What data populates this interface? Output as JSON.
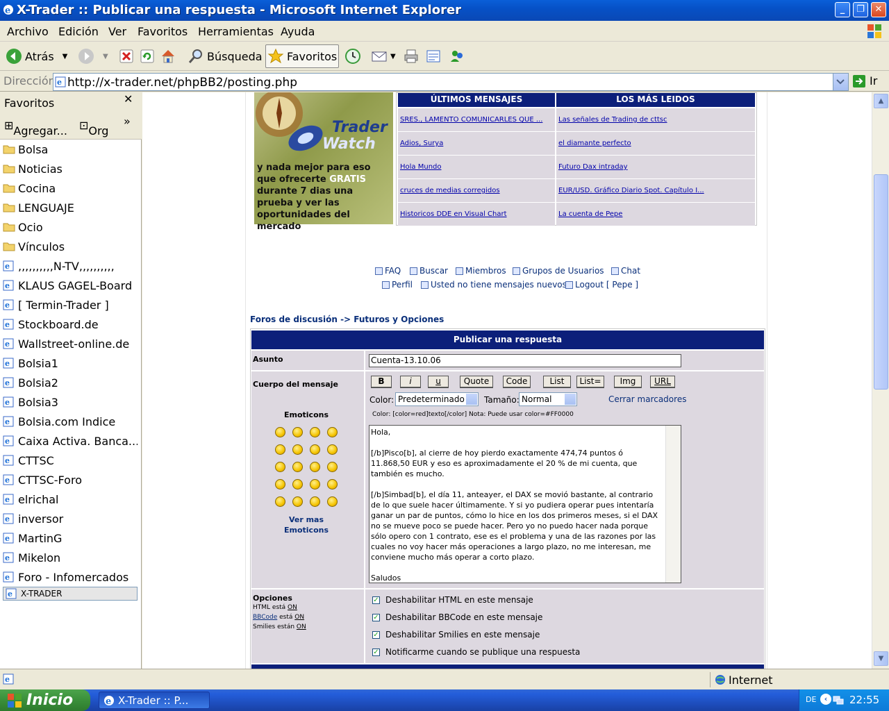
{
  "window": {
    "title": "X-Trader :: Publicar una respuesta - Microsoft Internet Explorer"
  },
  "menu": [
    "Archivo",
    "Edición",
    "Ver",
    "Favoritos",
    "Herramientas",
    "Ayuda"
  ],
  "toolbar": {
    "back": "Atrás",
    "search": "Búsqueda",
    "favorites": "Favoritos"
  },
  "address": {
    "label": "Dirección",
    "url": "http://x-trader.net/phpBB2/posting.php",
    "go": "Ir"
  },
  "favorites_pane": {
    "title": "Favoritos",
    "add": "Agregar...",
    "organize": "Org",
    "items": [
      {
        "label": "Bolsa",
        "type": "folder"
      },
      {
        "label": "Noticias",
        "type": "folder"
      },
      {
        "label": "Cocina",
        "type": "folder"
      },
      {
        "label": "LENGUAJE",
        "type": "folder"
      },
      {
        "label": "Ocio",
        "type": "folder"
      },
      {
        "label": "Vínculos",
        "type": "folder"
      },
      {
        "label": ",,,,,,,,,,N-TV,,,,,,,,,,",
        "type": "link"
      },
      {
        "label": "KLAUS GAGEL-Board",
        "type": "link"
      },
      {
        "label": "[ Termin-Trader ]",
        "type": "link"
      },
      {
        "label": "Stockboard.de",
        "type": "link"
      },
      {
        "label": "Wallstreet-online.de",
        "type": "link"
      },
      {
        "label": "Bolsia1",
        "type": "link"
      },
      {
        "label": "Bolsia2",
        "type": "link"
      },
      {
        "label": "Bolsia3",
        "type": "link"
      },
      {
        "label": "Bolsia.com  Indice",
        "type": "link"
      },
      {
        "label": "Caixa Activa. Banca...",
        "type": "link"
      },
      {
        "label": "CTTSC",
        "type": "link"
      },
      {
        "label": "CTTSC-Foro",
        "type": "link"
      },
      {
        "label": "elrichal",
        "type": "link"
      },
      {
        "label": "inversor",
        "type": "link"
      },
      {
        "label": "MartinG",
        "type": "link"
      },
      {
        "label": "Mikelon",
        "type": "link"
      },
      {
        "label": "Foro - Infomercados",
        "type": "link"
      },
      {
        "label": "X-TRADER",
        "type": "link"
      }
    ]
  },
  "banner": {
    "logo_top": "Trader",
    "logo_bottom": "Watch",
    "slogan_pre": "y nada mejor para eso que ofrecerte ",
    "slogan_highlight": "GRATIS",
    "slogan_post": " durante 7 dias una prueba y ver las oportunidades del mercado"
  },
  "messages_table": {
    "col1_header": "ÚLTIMOS MENSAJES",
    "col2_header": "LOS MÁS LEIDOS",
    "latest": [
      "SRES., LAMENTO COMUNICARLES QUE ...",
      "Adios, Surya",
      "Hola Mundo",
      "cruces de medias corregidos",
      "Historicos DDE en Visual Chart"
    ],
    "most_read": [
      "Las señales de Trading de cttsc",
      "el diamante perfecto",
      "Futuro Dax intraday",
      "EUR/USD. Gráfico Diario Spot. Capítulo I...",
      "La cuenta de Pepe"
    ]
  },
  "forum_nav": {
    "faq": "FAQ",
    "search": "Buscar",
    "members": "Miembros",
    "groups": "Grupos de Usuarios",
    "chat": "Chat",
    "profile": "Perfil",
    "no_messages": "Usted no tiene mensajes nuevos",
    "logout": "Logout [ Pepe ]"
  },
  "breadcrumb": "Foros de discusión -> Futuros y Opciones",
  "post_form": {
    "header": "Publicar una respuesta",
    "subject_label": "Asunto",
    "subject_value": "Cuenta-13.10.06",
    "body_label": "Cuerpo del mensaje",
    "buttons": [
      "B",
      "i",
      "u",
      "Quote",
      "Code",
      "List",
      "List=",
      "Img",
      "URL"
    ],
    "color_label": "Color:",
    "color_value": "Predeterminado",
    "size_label": "Tamaño:",
    "size_value": "Normal",
    "close_tags": "Cerrar marcadores",
    "hint": "Color: [color=red]texto[/color]  Nota: Puede usar color=#FF0000",
    "emoticons_title": "Emoticons",
    "more_emoticons_1": "Ver mas",
    "more_emoticons_2": "Emoticons",
    "body_text": "Hola,\n\n[/b]Pisco[b], al cierre de hoy pierdo exactamente 474,74 puntos ó 11.868,50 EUR y eso es aproximadamente el 20 % de mi cuenta, que también es mucho.\n\n[/b]Simbad[b], el día 11, anteayer, el DAX se movió bastante, al contrario de lo que suele hacer últimamente. Y si yo pudiera operar pues intentaría ganar un par de puntos, cómo lo hice en los dos primeros meses, si el DAX no se mueve poco se puede hacer. Pero yo no puedo hacer nada porque sólo opero con 1 contrato, ese es el problema y una de las razones por las cuales no voy hacer más operaciones a largo plazo, no me interesan, me conviene mucho más operar a corto plazo.\n\nSaludos",
    "options_label": "Opciones",
    "html_status_pre": "HTML está ",
    "html_status": "ON",
    "bbcode_link": "BBCode",
    "bbcode_status_mid": " está ",
    "bbcode_status": "ON",
    "smilies_status_pre": "Smilies están ",
    "smilies_status": "ON",
    "options": [
      "Deshabilitar HTML en este mensaje",
      "Deshabilitar BBCode en este mensaje",
      "Deshabilitar Smilies en este mensaje",
      "Notificarme cuando se publique una respuesta"
    ]
  },
  "status_bar": {
    "zone": "Internet"
  },
  "taskbar": {
    "start": "Inicio",
    "task": "X-Trader :: P...",
    "lang": "DE",
    "clock": "22:55"
  }
}
